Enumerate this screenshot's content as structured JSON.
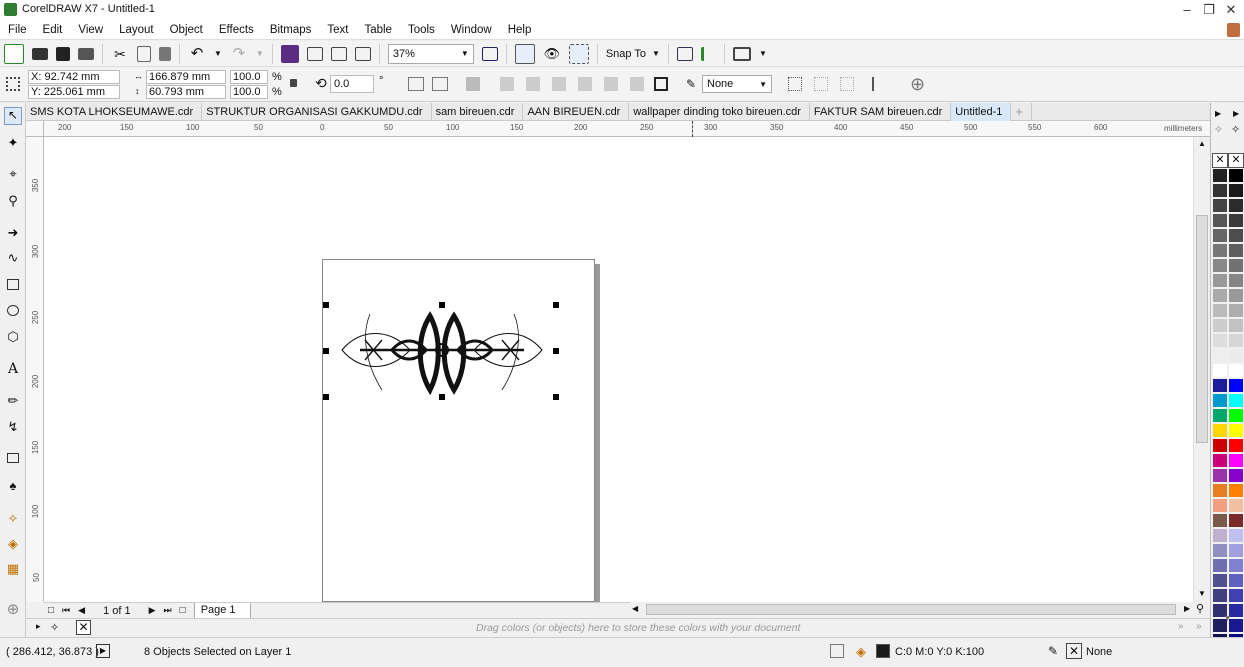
{
  "window": {
    "title": "CorelDRAW X7 - Untitled-1"
  },
  "menu": [
    "File",
    "Edit",
    "View",
    "Layout",
    "Object",
    "Effects",
    "Bitmaps",
    "Text",
    "Table",
    "Tools",
    "Window",
    "Help"
  ],
  "standard_toolbar": {
    "zoom": "37%",
    "snap_label": "Snap To"
  },
  "property_bar": {
    "x": "X: 92.742 mm",
    "y": "Y: 225.061 mm",
    "width": "166.879 mm",
    "height": "60.793 mm",
    "scale_x": "100.0",
    "scale_y": "100.0",
    "pct": "%",
    "angle": "0.0",
    "degree": "°",
    "outline": "None"
  },
  "doc_tabs": [
    {
      "label": "SMS KOTA LHOKSEUMAWE.cdr"
    },
    {
      "label": "STRUKTUR ORGANISASI GAKKUMDU.cdr"
    },
    {
      "label": "sam bireuen.cdr"
    },
    {
      "label": "AAN BIREUEN.cdr"
    },
    {
      "label": "wallpaper dinding toko bireuen.cdr"
    },
    {
      "label": "FAKTUR SAM bireuen.cdr"
    },
    {
      "label": "Untitled-1"
    }
  ],
  "hruler": {
    "labels": [
      "200",
      "150",
      "100",
      "50",
      "0",
      "50",
      "100",
      "150",
      "200",
      "250",
      "300",
      "350",
      "400",
      "450",
      "500",
      "550",
      "600"
    ],
    "units": "millimeters"
  },
  "vruler": {
    "labels": [
      "350",
      "300",
      "250",
      "200",
      "150",
      "100",
      "50"
    ],
    "units": "millimeters"
  },
  "page_nav": {
    "count": "1 of 1",
    "page_tab": "Page 1"
  },
  "doc_palette": {
    "hint": "Drag colors (or objects) here to store these colors with your document"
  },
  "status": {
    "coords": "( 286.412, 36.873 )",
    "selection": "8 Objects Selected on Layer 1",
    "fill": "C:0 M:0 Y:0 K:100",
    "outline": "None"
  },
  "palette_colors": [
    [
      "#222222",
      "#000000"
    ],
    [
      "#333333",
      "#1a1a1a"
    ],
    [
      "#444444",
      "#2b2b2b"
    ],
    [
      "#555555",
      "#3a3a3a"
    ],
    [
      "#666666",
      "#4d4d4d"
    ],
    [
      "#777777",
      "#5e5e5e"
    ],
    [
      "#888888",
      "#727272"
    ],
    [
      "#999999",
      "#858585"
    ],
    [
      "#aaaaaa",
      "#999999"
    ],
    [
      "#bbbbbb",
      "#adadad"
    ],
    [
      "#cccccc",
      "#c2c2c2"
    ],
    [
      "#dddddd",
      "#d6d6d6"
    ],
    [
      "#eeeeee",
      "#ebebeb"
    ],
    [
      "#ffffff",
      "#ffffff"
    ],
    [
      "#1c1c9c",
      "#0000ff"
    ],
    [
      "#0099cc",
      "#00ffff"
    ],
    [
      "#00a86b",
      "#00ff00"
    ],
    [
      "#ffd700",
      "#ffff00"
    ],
    [
      "#cc0000",
      "#ff0000"
    ],
    [
      "#cc0077",
      "#ff00ff"
    ],
    [
      "#9933aa",
      "#8800cc"
    ],
    [
      "#e87e22",
      "#ff8000"
    ],
    [
      "#f0a080",
      "#f0c0a0"
    ],
    [
      "#7a5a4a",
      "#7a2a2a"
    ],
    [
      "#c0b0d0",
      "#c0c0f0"
    ],
    [
      "#9090c0",
      "#a0a0e0"
    ],
    [
      "#7070b0",
      "#8080d0"
    ],
    [
      "#505090",
      "#6060c0"
    ],
    [
      "#404080",
      "#4040b0"
    ],
    [
      "#303070",
      "#2a2aa0"
    ],
    [
      "#202060",
      "#1a1a90"
    ],
    [
      "#101050",
      "#0a0a80"
    ]
  ]
}
